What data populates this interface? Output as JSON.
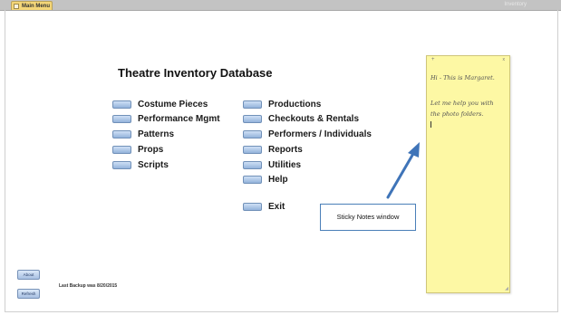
{
  "window": {
    "tab_label": "Main Menu",
    "topbar_right_text": "Inventory"
  },
  "main": {
    "title": "Theatre Inventory Database",
    "left_items": [
      {
        "label": "Costume Pieces"
      },
      {
        "label": "Performance Mgmt"
      },
      {
        "label": "Patterns"
      },
      {
        "label": "Props"
      },
      {
        "label": "Scripts"
      }
    ],
    "right_items": [
      {
        "label": "Productions"
      },
      {
        "label": "Checkouts & Rentals"
      },
      {
        "label": "Performers / Individuals"
      },
      {
        "label": "Reports"
      },
      {
        "label": "Utilities"
      },
      {
        "label": "Help"
      }
    ],
    "exit_label": "Exit"
  },
  "footer": {
    "about_label": "About",
    "refresh_label": "Refresh",
    "backup_text": "Last Backup was 8/20/2015"
  },
  "sticky_note": {
    "add_symbol": "+",
    "close_symbol": "x",
    "line1": "Hi - This is Margaret.",
    "line2": "Let me help you with",
    "line3": "the photo folders.",
    "background_color": "#fdf8a4"
  },
  "callout": {
    "text": "Sticky Notes window",
    "arrow_color": "#3f74b8"
  }
}
